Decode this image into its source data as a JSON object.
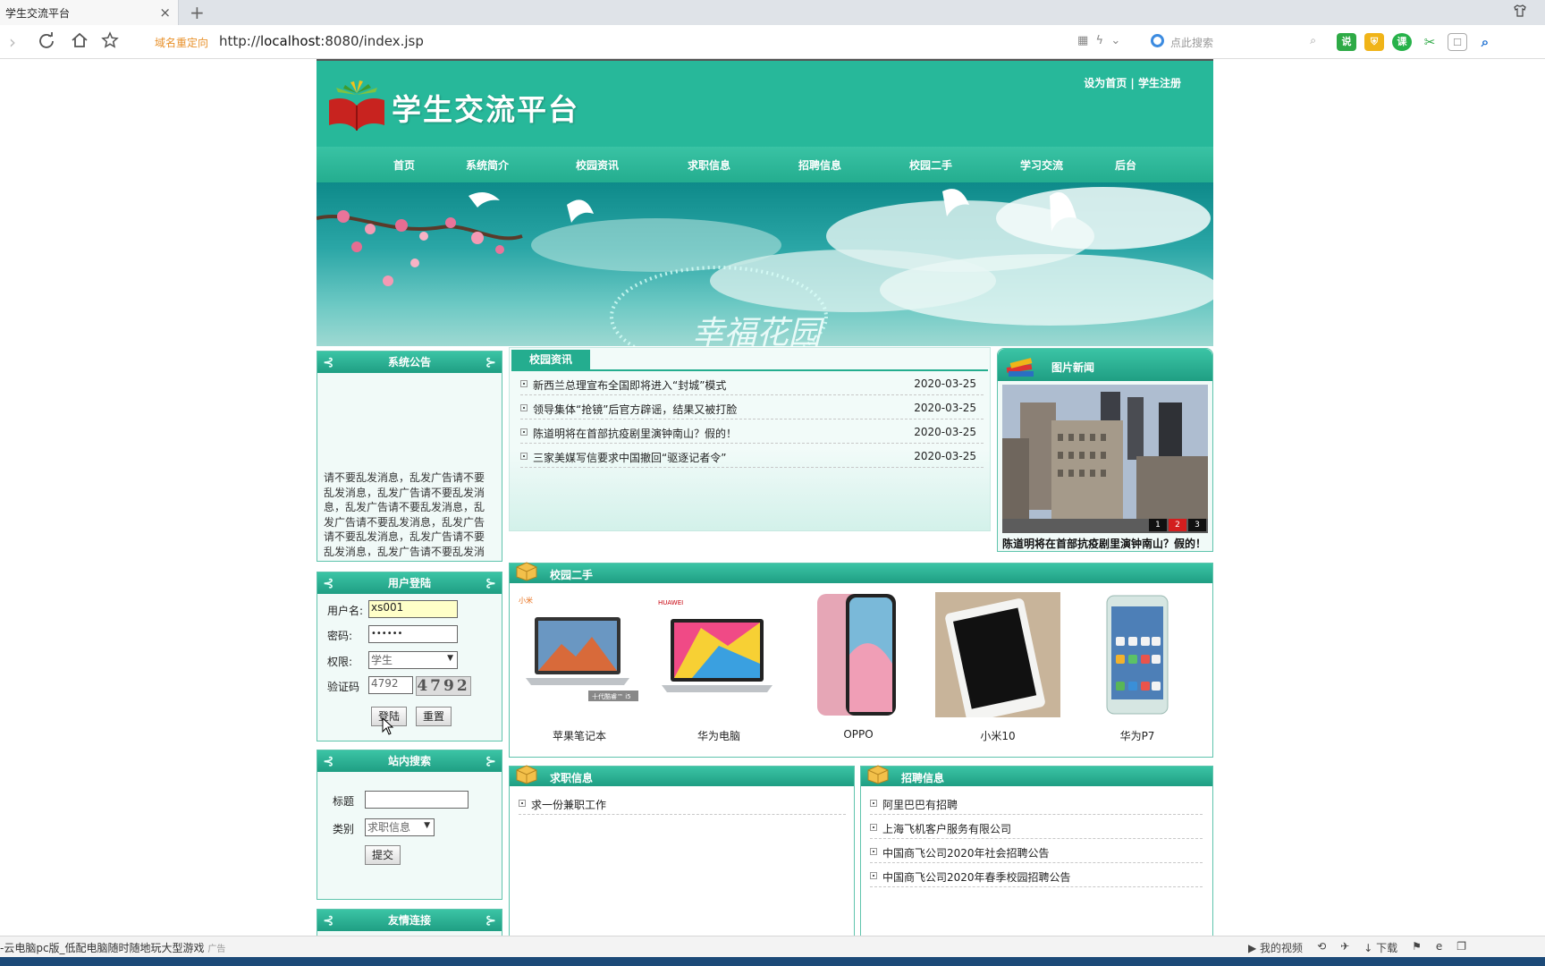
{
  "browser": {
    "tab_title": "学生交流平台",
    "tab_close": "×",
    "new_tab": "+",
    "redirect_label": "域名重定向",
    "url_prefix": "http://",
    "url_host": "localhost",
    "url_rest": ":8080/index.jsp",
    "search_placeholder": "点此搜索",
    "extensions": [
      "sbq",
      "shield",
      "ke",
      "scissors",
      "window",
      "search-tool"
    ]
  },
  "site": {
    "title": "学生交流平台",
    "top_links": {
      "homepage": "设为首页",
      "separator": "|",
      "register": "学生注册"
    },
    "nav": [
      "首页",
      "系统简介",
      "校园资讯",
      "求职信息",
      "招聘信息",
      "校园二手",
      "学习交流",
      "后台"
    ],
    "banner_text": "幸福花园"
  },
  "notice": {
    "title": "系统公告",
    "text": "请不要乱发消息，乱发广告请不要乱发消息，乱发广告请不要乱发消息，乱发广告请不要乱发消息，乱发广告请不要乱发消息，乱发广告请不要乱发消息，乱发广告请不要乱发消息，乱发广告请不要乱发消息"
  },
  "login": {
    "title": "用户登陆",
    "username_label": "用户名:",
    "username_value": "xs001",
    "password_label": "密码:",
    "password_value": "••••••",
    "role_label": "权限:",
    "role_value": "学生",
    "captcha_label": "验证码",
    "captcha_value": "4792",
    "captcha_image_text": "4792",
    "login_button": "登陆",
    "reset_button": "重置"
  },
  "site_search": {
    "title": "站内搜索",
    "title_label": "标题",
    "title_value": "",
    "category_label": "类别",
    "category_value": "求职信息",
    "submit_button": "提交"
  },
  "links": {
    "title": "友情连接"
  },
  "campus_news": {
    "tab": "校园资讯",
    "items": [
      {
        "title": "新西兰总理宣布全国即将进入“封城”模式",
        "date": "2020-03-25"
      },
      {
        "title": "领导集体“抢镜”后官方辟谣，结果又被打脸",
        "date": "2020-03-25"
      },
      {
        "title": "陈道明将在首部抗疫剧里演钟南山？假的！",
        "date": "2020-03-25"
      },
      {
        "title": "三家美媒写信要求中国撤回“驱逐记者令”",
        "date": "2020-03-25"
      }
    ]
  },
  "photo_news": {
    "title": "图片新闻",
    "caption": "陈道明将在首部抗疫剧里演钟南山？假的！",
    "pages": [
      "1",
      "2",
      "3"
    ],
    "active_page": "2"
  },
  "second_hand": {
    "title": "校园二手",
    "items": [
      {
        "name": "苹果笔记本",
        "brand": "小米",
        "badge": "十代酷睿™ i5"
      },
      {
        "name": "华为电脑",
        "brand": "HUAWEI"
      },
      {
        "name": "OPPO"
      },
      {
        "name": "小米10"
      },
      {
        "name": "华为P7"
      }
    ]
  },
  "jobs": {
    "title": "求职信息",
    "items": [
      "求一份兼职工作"
    ]
  },
  "recruit": {
    "title": "招聘信息",
    "items": [
      "阿里巴巴有招聘",
      "上海飞机客户服务有限公司",
      "中国商飞公司2020年社会招聘公告",
      "中国商飞公司2020年春季校园招聘公告"
    ]
  },
  "status": {
    "left_text": "-云电脑pc版_低配电脑随时随地玩大型游戏",
    "ad_tag": "广告",
    "right_items": [
      "我的视频",
      "下载"
    ]
  }
}
